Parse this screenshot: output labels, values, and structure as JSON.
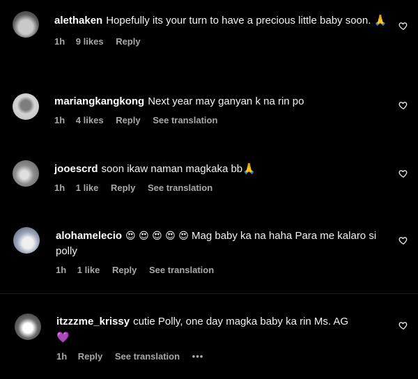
{
  "comments": [
    {
      "username": "alethaken",
      "text": "Hopefully its your turn to have a precious little baby soon. 🙏",
      "time": "1h",
      "likes": "9 likes",
      "reply": "Reply"
    },
    {
      "username": "mariangkangkong",
      "text": "Next year may ganyan k na rin po",
      "time": "1h",
      "likes": "4 likes",
      "reply": "Reply",
      "translate": "See translation"
    },
    {
      "username": "jooescrd",
      "text": "soon ikaw naman magkaka bb🙏",
      "time": "1h",
      "likes": "1 like",
      "reply": "Reply",
      "translate": "See translation"
    },
    {
      "username": "alohamelecio",
      "emojis": "😍 😍 😍 😍 😍",
      "text": "Mag baby ka na haha Para me kalaro si polly",
      "time": "1h",
      "likes": "1 like",
      "reply": "Reply",
      "translate": "See translation"
    },
    {
      "username": "itzzzme_krissy",
      "text": "cutie Polly, one day magka baby ka rin Ms. AG",
      "heart": "💜",
      "time": "1h",
      "reply": "Reply",
      "translate": "See translation",
      "more": "•••"
    }
  ],
  "colors": {
    "background": "#000000",
    "text": "#f2f2f2",
    "meta": "#a8a8a8",
    "heart_emoji": "#a98cff"
  },
  "icons": {
    "like": "heart-outline-icon"
  }
}
